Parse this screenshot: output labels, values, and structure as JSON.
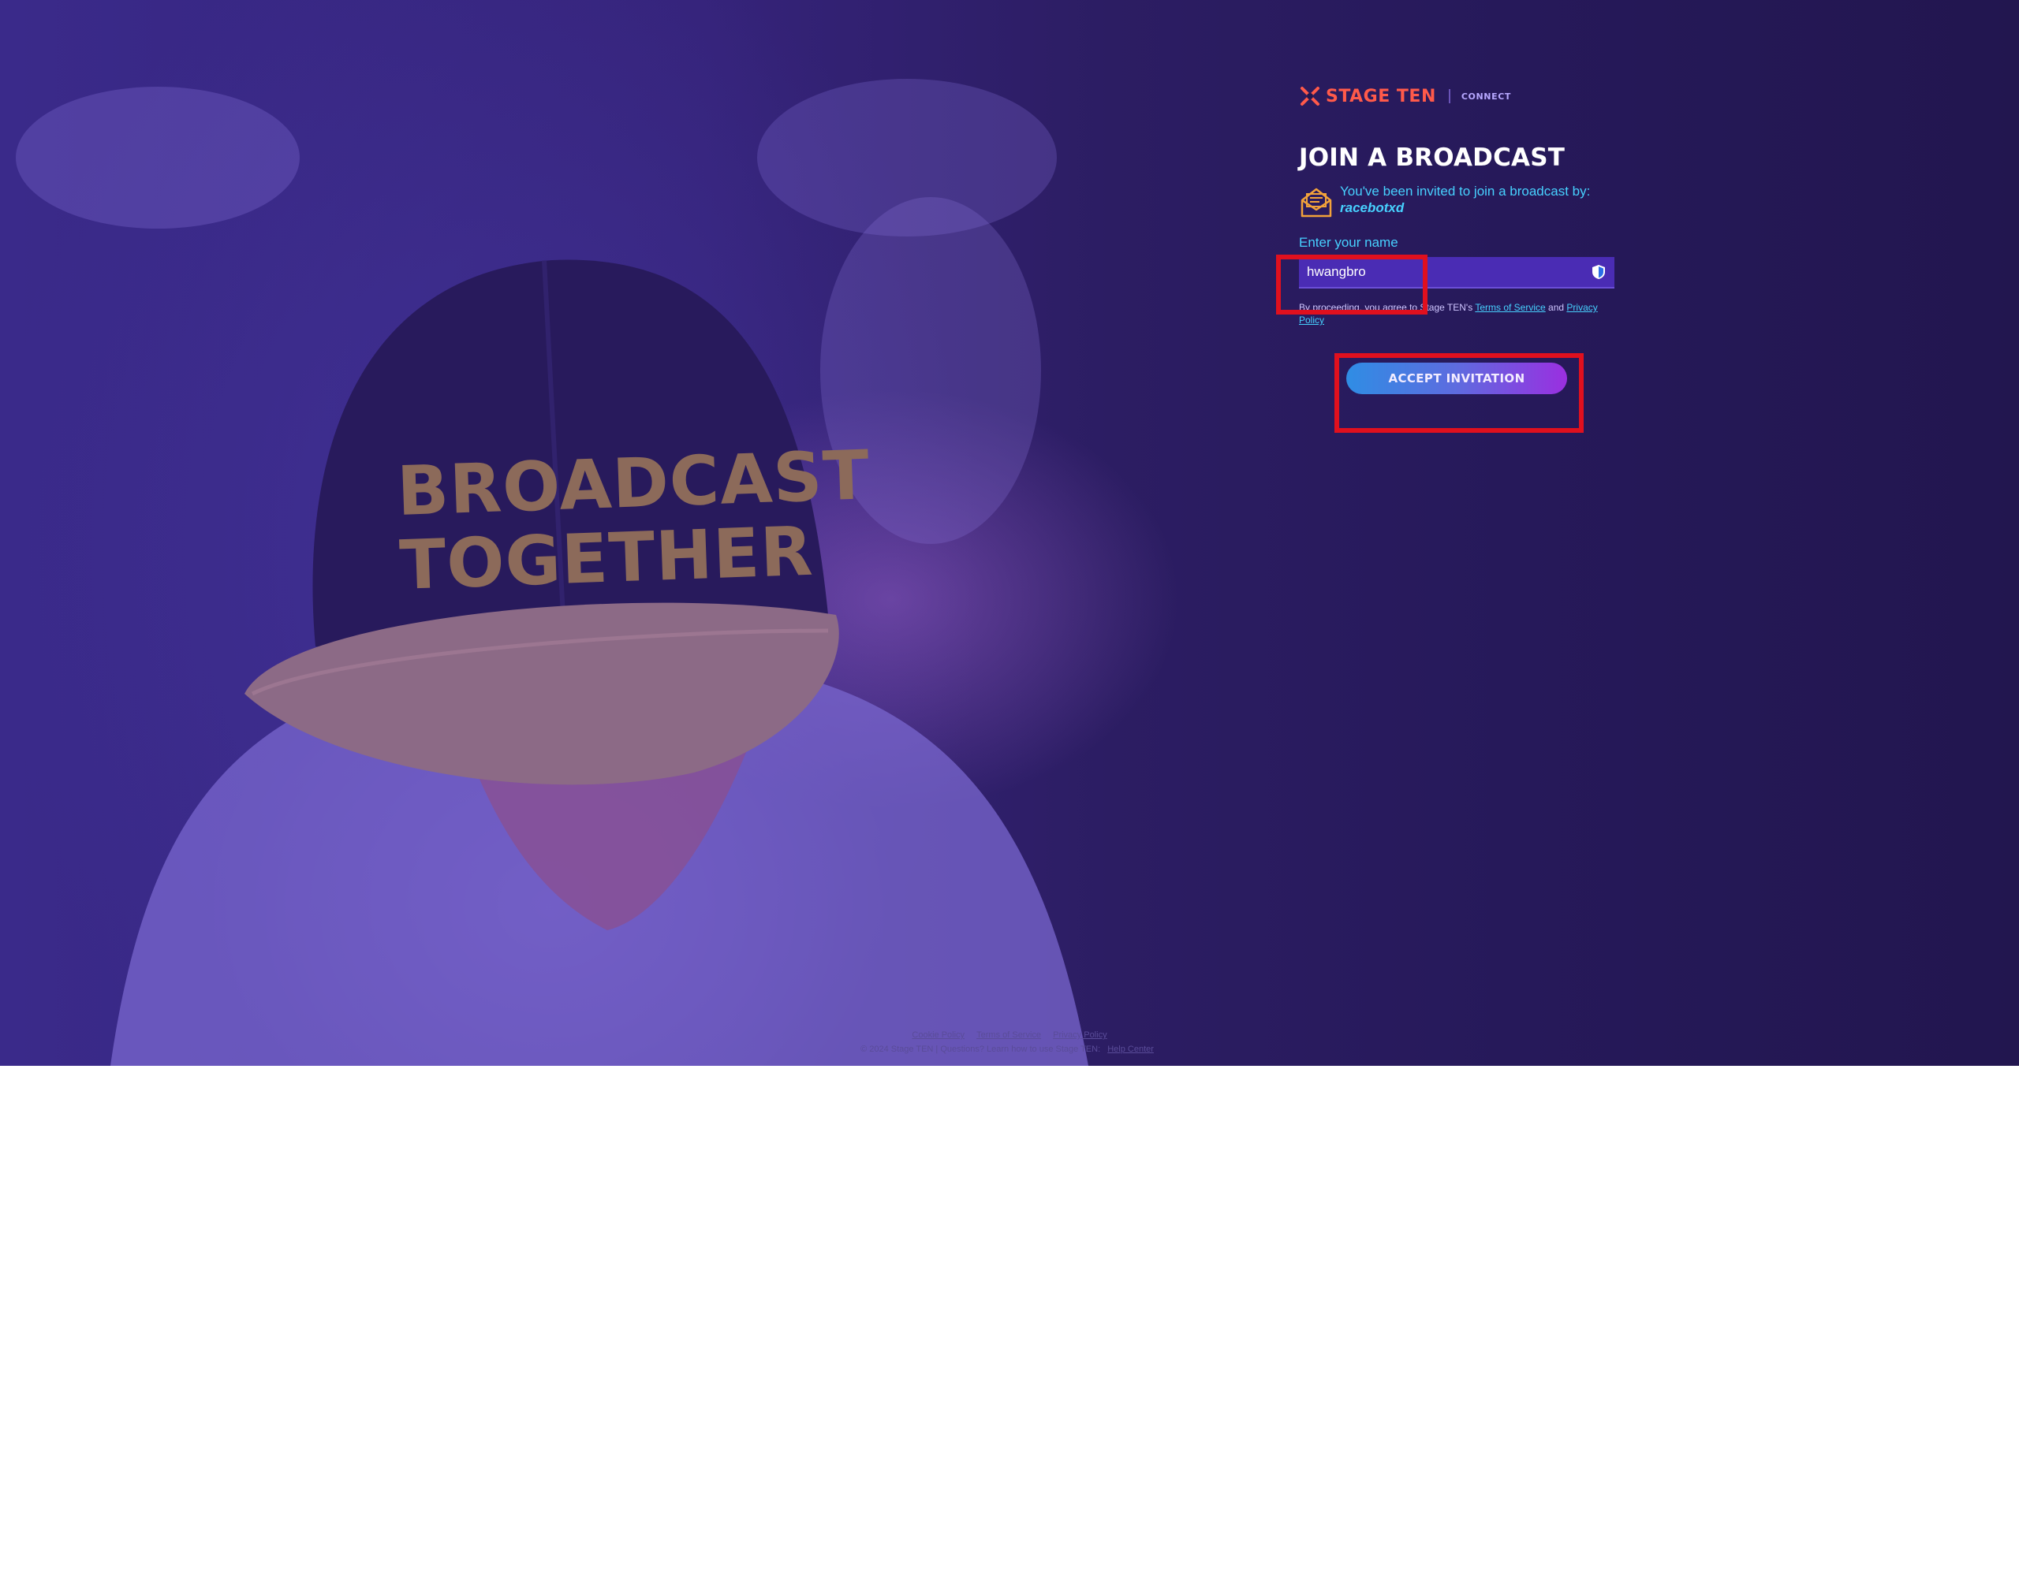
{
  "brand": {
    "name": "STAGE TEN",
    "product": "CONNECT",
    "accent_color": "#ff5a4a"
  },
  "hero_image": {
    "cap_text_line1": "BROADCAST",
    "cap_text_line2": "TOGETHER"
  },
  "form": {
    "title": "JOIN A BROADCAST",
    "invite_text": "You've been invited to join a broadcast by:",
    "invite_user": "racebotxd",
    "name_label": "Enter your name",
    "name_value": "hwangbro",
    "legal_prefix": "By proceeding, you agree to Stage TEN's",
    "legal_tos": "Terms of Service",
    "legal_and": "and",
    "legal_privacy": "Privacy Policy",
    "submit_label": "ACCEPT INVITATION"
  },
  "footer": {
    "links": [
      "Cookie Policy",
      "Terms of Service",
      "Privacy Policy"
    ],
    "copyright": "© 2024 Stage TEN | Questions? Learn how to use Stage TEN:",
    "help_link": "Help Center"
  }
}
